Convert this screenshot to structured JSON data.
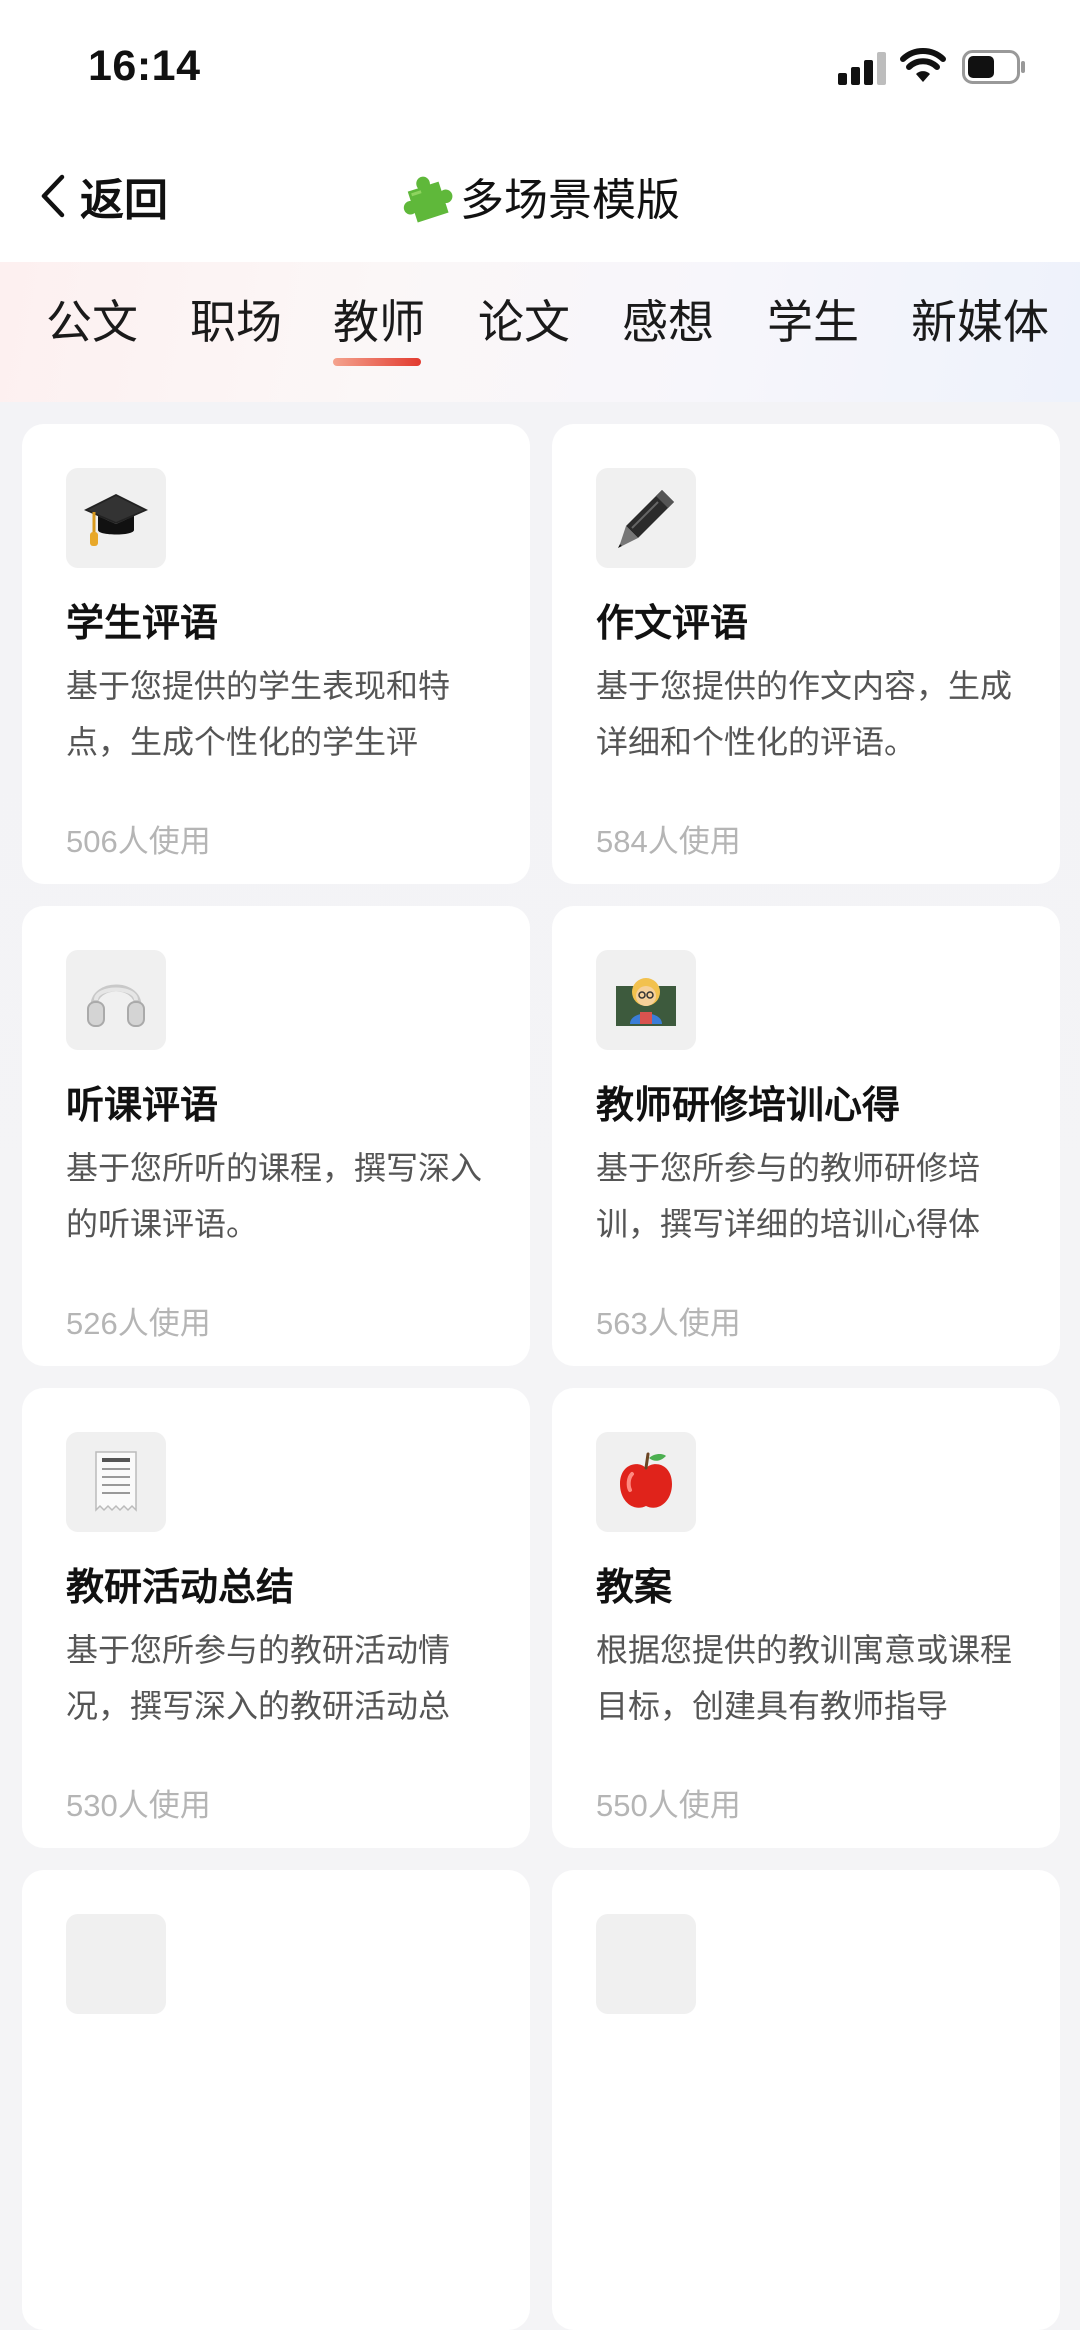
{
  "status_bar": {
    "time": "16:14"
  },
  "nav": {
    "back_label": "返回",
    "title": "多场景模版"
  },
  "tabs": [
    {
      "label": "公文",
      "active": false
    },
    {
      "label": "职场",
      "active": false
    },
    {
      "label": "教师",
      "active": true
    },
    {
      "label": "论文",
      "active": false
    },
    {
      "label": "感想",
      "active": false
    },
    {
      "label": "学生",
      "active": false
    },
    {
      "label": "新媒体",
      "active": false
    }
  ],
  "cards": [
    {
      "icon": "graduation-cap-icon",
      "title": "学生评语",
      "desc": "基于您提供的学生表现和特点，生成个性化的学生评",
      "usage": "506人使用"
    },
    {
      "icon": "pen-icon",
      "title": "作文评语",
      "desc": "基于您提供的作文内容，生成详细和个性化的评语。",
      "usage": "584人使用"
    },
    {
      "icon": "headphones-icon",
      "title": "听课评语",
      "desc": "基于您所听的课程，撰写深入的听课评语。",
      "usage": "526人使用"
    },
    {
      "icon": "teacher-icon",
      "title": "教师研修培训心得",
      "desc": "基于您所参与的教师研修培训，撰写详细的培训心得体",
      "usage": "563人使用"
    },
    {
      "icon": "receipt-icon",
      "title": "教研活动总结",
      "desc": "基于您所参与的教研活动情况，撰写深入的教研活动总",
      "usage": "530人使用"
    },
    {
      "icon": "apple-icon",
      "title": "教案",
      "desc": "根据您提供的教训寓意或课程目标，创建具有教师指导",
      "usage": "550人使用"
    }
  ],
  "colors": {
    "accent": "#e23a2f",
    "background": "#f4f4f6",
    "card": "#ffffff"
  }
}
